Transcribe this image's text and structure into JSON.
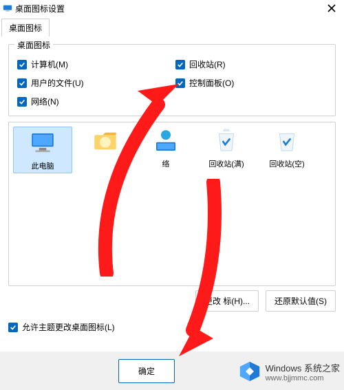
{
  "titlebar": {
    "title": "桌面图标设置"
  },
  "tabs": {
    "main": "桌面图标"
  },
  "group": {
    "legend": "桌面图标",
    "computer": "计算机(M)",
    "recycle": "回收站(R)",
    "userfiles": "用户的文件(U)",
    "controlpanel": "控制面板(O)",
    "network": "网络(N)"
  },
  "icons": {
    "this_pc": "此电脑",
    "net": "络",
    "recycle_full": "回收站(满)",
    "recycle_empty": "回收站(空)"
  },
  "buttons": {
    "change_icon": "更改   标(H)...",
    "restore_defaults": "还原默认值(S)",
    "ok": "确定"
  },
  "allow": {
    "label": "允许主题更改桌面图标(L)"
  },
  "watermark": {
    "brand": "Windows",
    "sub": "系统之家",
    "url": "www.bjjmmc.com"
  }
}
